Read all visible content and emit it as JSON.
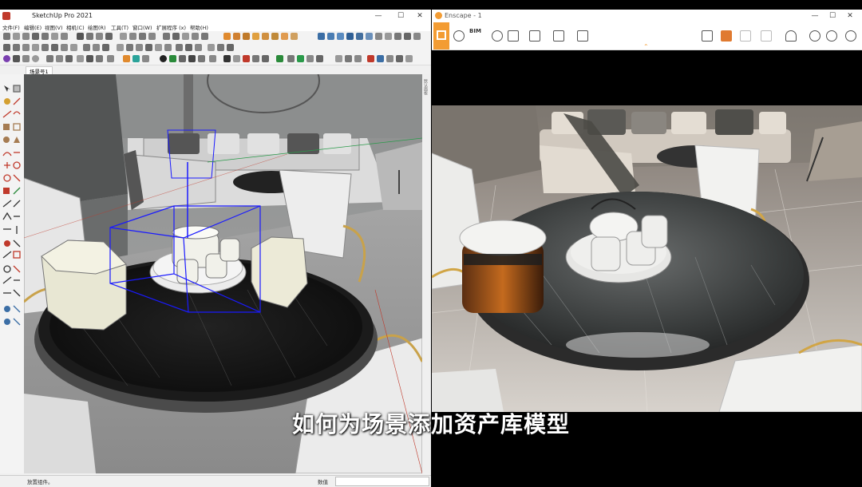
{
  "sketchup": {
    "title": "SketchUp Pro 2021",
    "menus": [
      "文件(F)",
      "编辑(E)",
      "视图(V)",
      "相机(C)",
      "绘图(R)",
      "工具(T)",
      "窗口(W)",
      "扩展程序 (x)",
      "帮助(H)"
    ],
    "scene_tab": "场景号1",
    "right_panel_label": "默认面板",
    "status_left": "放置组件。",
    "status_measure_label": "数值"
  },
  "enscape": {
    "title": "Enscape - 1",
    "bim_label": "BIM"
  },
  "window_controls": {
    "minimize": "—",
    "maximize": "☐",
    "close": "✕"
  },
  "subtitle": "如何为场景添加资产库模型",
  "colors": {
    "accent": "#f39c33",
    "selection": "#1a1aff"
  }
}
